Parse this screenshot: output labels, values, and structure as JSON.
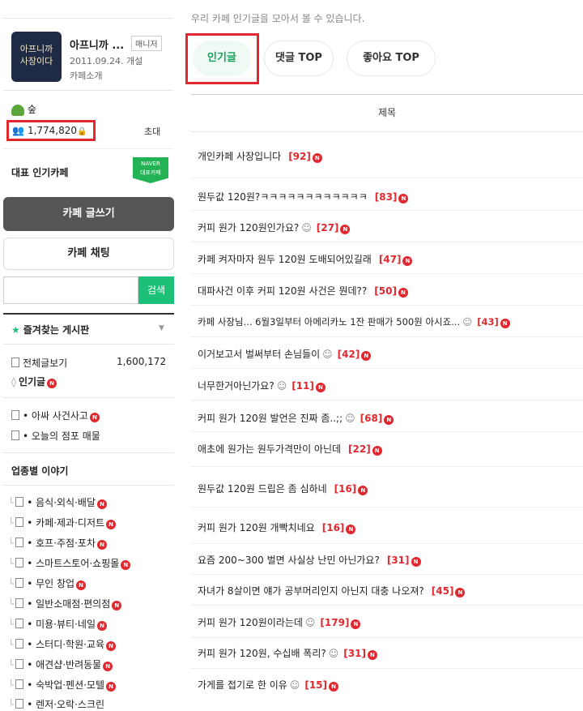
{
  "sidebar": {
    "cafe": {
      "thumb_line1": "아프니까",
      "thumb_line2": "사장이다",
      "name": "아프니까 ...",
      "manager_badge": "매니저",
      "date": "2011.09.24. 개설",
      "intro": "카페소개"
    },
    "level": "숲",
    "member_count": "1,774,820",
    "invite": "초대",
    "rep_label": "대표 인기카페",
    "naver_badge_line1": "NAVER",
    "naver_badge_line2": "대표카페",
    "write_button": "카페 글쓰기",
    "chat_button": "카페 채팅",
    "search_button": "검색",
    "favorites_label": "즐겨찾는 게시판",
    "all_posts_label": "전체글보기",
    "all_posts_count": "1,600,172",
    "popular_label": "인기글",
    "pinned": [
      {
        "label": "• 아싸 사건사고"
      },
      {
        "label": "• 오늘의 점포 매물"
      }
    ],
    "section_title": "업종별 이야기",
    "categories": [
      {
        "label": "• 음식·외식·배달"
      },
      {
        "label": "• 카페·제과·디저트"
      },
      {
        "label": "• 호프·주점·포차"
      },
      {
        "label": "• 스마트스토어·쇼핑몰"
      },
      {
        "label": "• 무인 창업"
      },
      {
        "label": "• 일반소매점·편의점"
      },
      {
        "label": "• 미용·뷰티·네일"
      },
      {
        "label": "• 스터디·학원·교육"
      },
      {
        "label": "• 애견샵·반려동물"
      },
      {
        "label": "• 숙박업·펜션·모텔"
      },
      {
        "label": "• 렌저·오락·스크린"
      }
    ]
  },
  "main": {
    "intro": "우리 카페 인기글을 모아서 볼 수 있습니다.",
    "tabs": [
      {
        "label": "인기글"
      },
      {
        "label": "댓글 TOP"
      },
      {
        "label": "좋아요 TOP"
      }
    ],
    "column_header": "제목",
    "posts": [
      {
        "title": "개인카페 사장입니다",
        "emoji": "",
        "count": "[92]"
      },
      {
        "title": "원두값 120원?ㅋㅋㅋㅋㅋㅋㅋㅋㅋㅋㅋㅋ",
        "emoji": "",
        "count": "[83]"
      },
      {
        "title": "커피 원가 120원인가요?",
        "emoji": "☺",
        "count": "[27]"
      },
      {
        "title": "카페 켜자마자 원두 120원 도배되어있길래",
        "emoji": "",
        "count": "[47]"
      },
      {
        "title": "대파사건 이후 커피 120원 사건은 뭔데??",
        "emoji": "",
        "count": "[50]"
      },
      {
        "title": "카페 사장님... 6월3일부터 아메리카노 1잔 판매가 500원 아시죠...",
        "emoji": "☺",
        "count": "[43]"
      },
      {
        "title": "이거보고서 벌써부터 손님들이",
        "emoji": "☺",
        "count": "[42]"
      },
      {
        "title": "너무한거아닌가요?",
        "emoji": "☺",
        "count": "[11]"
      },
      {
        "title": "커피 원가 120원 발언은 진짜 좀..;;",
        "emoji": "☺",
        "count": "[68]"
      },
      {
        "title": "애초에 원가는 원두가격만이 아닌데",
        "emoji": "",
        "count": "[22]"
      },
      {
        "title": "원두값 120원 드립은 좀 심하네",
        "emoji": "",
        "count": "[16]"
      },
      {
        "title": "커피 원가 120원 개빡치네요",
        "emoji": "",
        "count": "[16]"
      },
      {
        "title": "요즘 200~300 벌면 사실상 난민 아닌가요?",
        "emoji": "",
        "count": "[31]"
      },
      {
        "title": "자녀가 8살이면 얘가 공부머리인지 아닌지 대충 나오져?",
        "emoji": "",
        "count": "[45]"
      },
      {
        "title": "커피 원가 120원이라는데",
        "emoji": "☺",
        "count": "[179]"
      },
      {
        "title": "커피 원가 120원, 수십배 폭리?",
        "emoji": "☺",
        "count": "[31]"
      },
      {
        "title": "가게를 접기로 한 이유",
        "emoji": "☺",
        "count": "[15]"
      }
    ]
  },
  "badge_new": "N",
  "colors": {
    "accent_green": "#1dc078",
    "highlight_red": "#e0282e",
    "count_red": "#e0282e"
  }
}
